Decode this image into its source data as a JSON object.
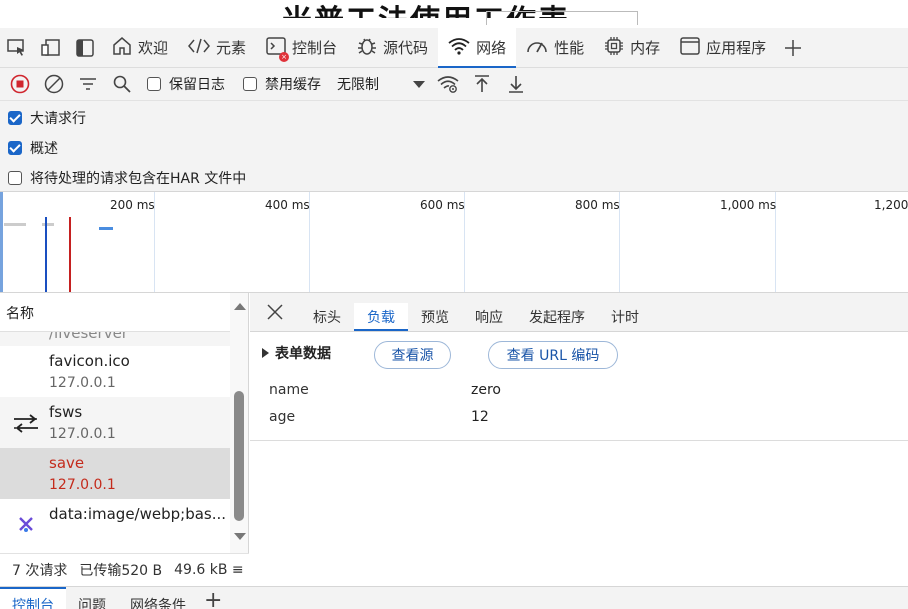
{
  "page": {
    "title_fragment": "米普工法使用工作表"
  },
  "tabs": [
    {
      "label": "欢迎",
      "icon": "home-icon"
    },
    {
      "label": "元素",
      "icon": "code-brackets-icon"
    },
    {
      "label": "控制台",
      "icon": "console-icon"
    },
    {
      "label": "源代码",
      "icon": "bug-icon"
    },
    {
      "label": "网络",
      "icon": "wifi-icon",
      "active": true
    },
    {
      "label": "性能",
      "icon": "gauge-icon"
    },
    {
      "label": "内存",
      "icon": "chip-icon"
    },
    {
      "label": "应用程序",
      "icon": "app-window-icon"
    }
  ],
  "toolbar": {
    "preserve_log": "保留日志",
    "disable_cache": "禁用缓存",
    "throttle": "无限制"
  },
  "options": {
    "big_rows": "大请求行",
    "overview": "概述",
    "include_pending_har": "将待处理的请求包含在HAR 文件中"
  },
  "timeline": {
    "ticks": [
      "200 ms",
      "400 ms",
      "600 ms",
      "800 ms",
      "1,000 ms",
      "1,200"
    ]
  },
  "list": {
    "header": "名称",
    "partial_top": "/liveserver",
    "requests": [
      {
        "name": "favicon.ico",
        "host": "127.0.0.1",
        "icon": "blank"
      },
      {
        "name": "fsws",
        "host": "127.0.0.1",
        "icon": "websocket-arrows-icon"
      },
      {
        "name": "save",
        "host": "127.0.0.1",
        "icon": "blank",
        "selected": true
      },
      {
        "name": "data:image/webp;bas...",
        "host": "",
        "icon": "image-webp-icon"
      }
    ]
  },
  "status": {
    "requests": "7 次请求",
    "transferred": "已传输520 B",
    "resources": "49.6 kB ≡"
  },
  "details": {
    "tabs": [
      "标头",
      "负载",
      "预览",
      "响应",
      "发起程序",
      "计时"
    ],
    "active_tab": "负载",
    "form_data_title": "表单数据",
    "view_source": "查看源",
    "view_url_encoded": "查看 URL 编码",
    "fields": [
      {
        "key": "name",
        "value": "zero"
      },
      {
        "key": "age",
        "value": "12"
      }
    ]
  },
  "drawer": {
    "tabs": [
      "控制台",
      "问题",
      "网络条件"
    ],
    "active": "控制台"
  }
}
